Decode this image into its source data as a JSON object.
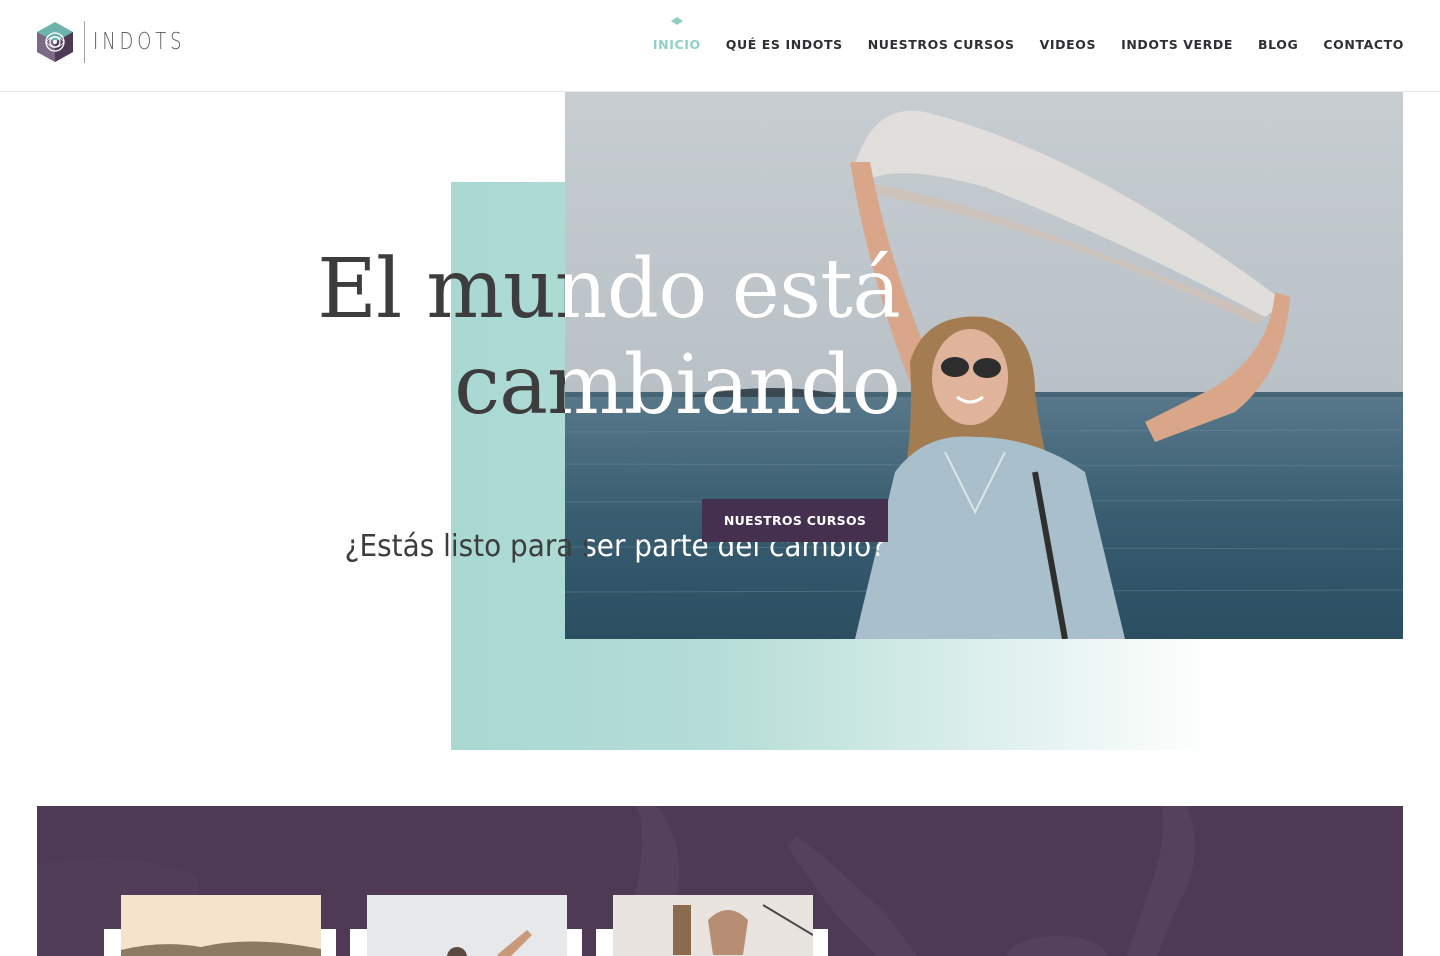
{
  "brand": {
    "name": "INDOTS"
  },
  "nav": {
    "items": [
      {
        "label": "INICIO",
        "active": true
      },
      {
        "label": "QUÉ ES INDOTS",
        "active": false
      },
      {
        "label": "NUESTROS CURSOS",
        "active": false
      },
      {
        "label": "VIDEOS",
        "active": false
      },
      {
        "label": "INDOTS VERDE",
        "active": false
      },
      {
        "label": "BLOG",
        "active": false
      },
      {
        "label": "CONTACTO",
        "active": false
      }
    ]
  },
  "hero": {
    "title_line1": "El mundo está",
    "title_line2": "cambiando",
    "subtitle": "¿Estás listo para ser parte del cambio?",
    "cta_label": "NUESTROS CURSOS"
  },
  "colors": {
    "accent_teal": "#8fcfc6",
    "panel_teal": "#a9d8d2",
    "brand_purple": "#45304f",
    "band_purple": "#4e3a55",
    "nav_text": "#2f2f34"
  },
  "icons": {
    "logo": "hexagon-mandala-logo-icon",
    "nav_marker": "diamond-marker-icon"
  }
}
